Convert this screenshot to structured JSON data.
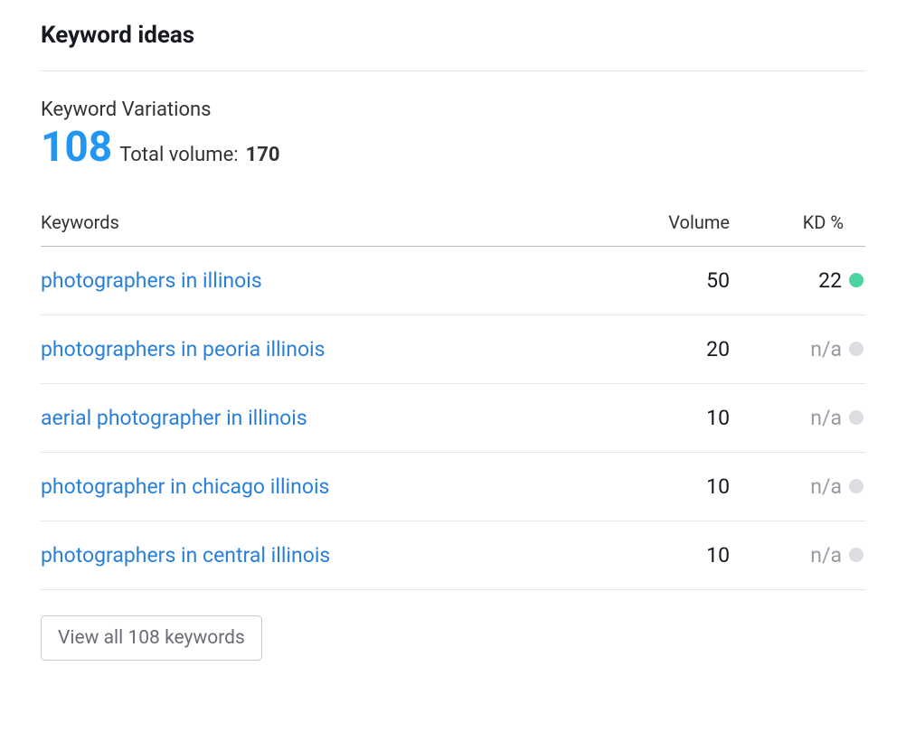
{
  "section": {
    "title": "Keyword ideas"
  },
  "variations": {
    "label": "Keyword Variations",
    "count": "108",
    "total_volume_label": "Total volume:",
    "total_volume_value": "170"
  },
  "table": {
    "headers": {
      "keywords": "Keywords",
      "volume": "Volume",
      "kd": "KD %"
    },
    "rows": [
      {
        "keyword": "photographers in illinois",
        "volume": "50",
        "kd": "22",
        "kd_na": false,
        "dot": "green"
      },
      {
        "keyword": "photographers in peoria illinois",
        "volume": "20",
        "kd": "n/a",
        "kd_na": true,
        "dot": "gray"
      },
      {
        "keyword": "aerial photographer in illinois",
        "volume": "10",
        "kd": "n/a",
        "kd_na": true,
        "dot": "gray"
      },
      {
        "keyword": "photographer in chicago illinois",
        "volume": "10",
        "kd": "n/a",
        "kd_na": true,
        "dot": "gray"
      },
      {
        "keyword": "photographers in central illinois",
        "volume": "10",
        "kd": "n/a",
        "kd_na": true,
        "dot": "gray"
      }
    ]
  },
  "footer": {
    "view_all_label": "View all 108 keywords"
  }
}
